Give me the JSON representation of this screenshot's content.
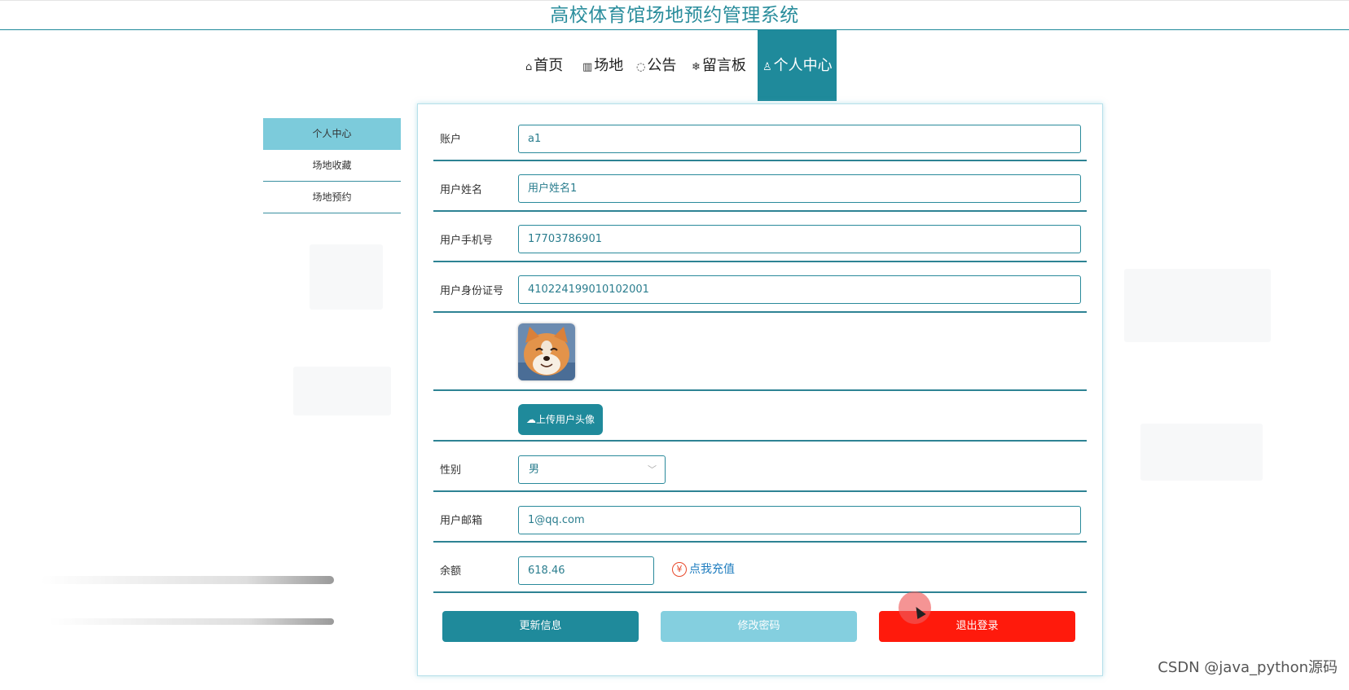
{
  "header": {
    "title": "高校体育馆场地预约管理系统"
  },
  "nav": {
    "items": [
      {
        "icon": "⌂",
        "label": "首页"
      },
      {
        "icon": "▥",
        "label": "场地"
      },
      {
        "icon": "◌",
        "label": "公告"
      },
      {
        "icon": "❄",
        "label": "留言板"
      },
      {
        "icon": "♙",
        "label": "个人中心"
      }
    ],
    "active_index": 4
  },
  "sidebar": {
    "items": [
      {
        "label": "个人中心",
        "active": true
      },
      {
        "label": "场地收藏",
        "active": false
      },
      {
        "label": "场地预约",
        "active": false
      }
    ]
  },
  "form": {
    "account": {
      "label": "账户",
      "value": "a1"
    },
    "name": {
      "label": "用户姓名",
      "value": "用户姓名1"
    },
    "phone": {
      "label": "用户手机号",
      "value": "17703786901"
    },
    "idcard": {
      "label": "用户身份证号",
      "value": "410224199010102001"
    },
    "upload": {
      "label": "上传用户头像",
      "icon": "cloud-upload-icon"
    },
    "gender": {
      "label": "性别",
      "value": "男"
    },
    "email": {
      "label": "用户邮箱",
      "value": "1@qq.com"
    },
    "balance": {
      "label": "余额",
      "value": "618.46",
      "recharge_label": "点我充值",
      "recharge_icon": "¥"
    }
  },
  "buttons": {
    "update": "更新信息",
    "password": "修改密码",
    "logout": "退出登录"
  },
  "colors": {
    "primary": "#1f8a9b",
    "light": "#84cfdf",
    "danger": "#ff1a0c",
    "link": "#1e7cbf"
  },
  "watermark": "CSDN @java_python源码"
}
